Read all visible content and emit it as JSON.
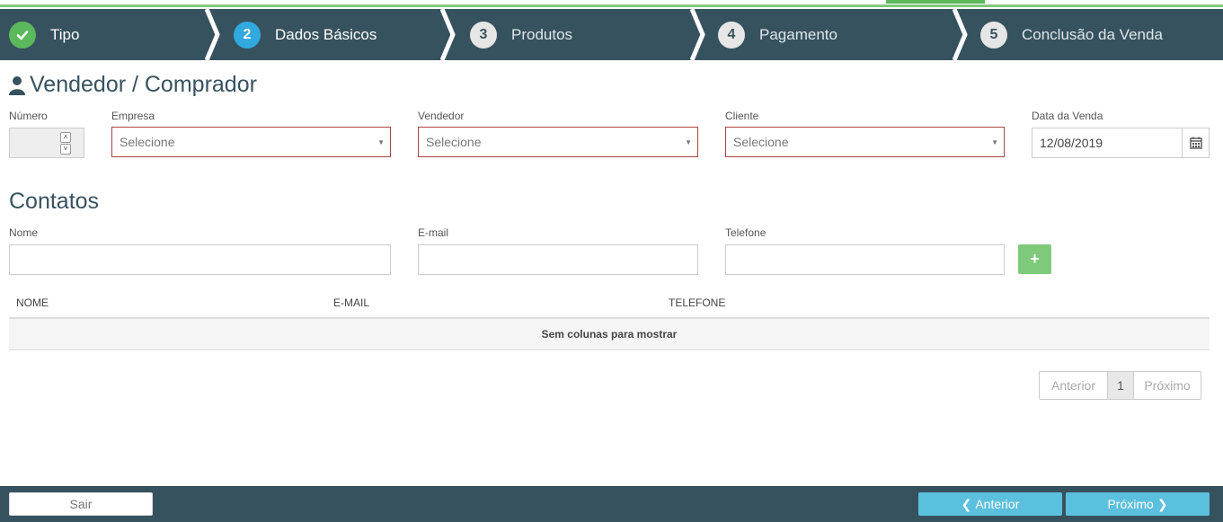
{
  "wizard": {
    "steps": [
      {
        "number": "",
        "label": "Tipo",
        "state": "done"
      },
      {
        "number": "2",
        "label": "Dados Básicos",
        "state": "active"
      },
      {
        "number": "3",
        "label": "Produtos",
        "state": "future"
      },
      {
        "number": "4",
        "label": "Pagamento",
        "state": "future"
      },
      {
        "number": "5",
        "label": "Conclusão da Venda",
        "state": "future"
      }
    ]
  },
  "seller_buyer": {
    "title": "Vendedor / Comprador",
    "numero_label": "Número",
    "numero_value": "",
    "empresa_label": "Empresa",
    "empresa_placeholder": "Selecione",
    "vendedor_label": "Vendedor",
    "vendedor_placeholder": "Selecione",
    "cliente_label": "Cliente",
    "cliente_placeholder": "Selecione",
    "data_label": "Data da Venda",
    "data_value": "12/08/2019"
  },
  "contacts": {
    "title": "Contatos",
    "nome_label": "Nome",
    "email_label": "E-mail",
    "telefone_label": "Telefone",
    "add_button": "+",
    "table": {
      "columns": [
        "NOME",
        "E-MAIL",
        "TELEFONE"
      ],
      "empty_message": "Sem colunas para mostrar"
    },
    "pager": {
      "prev": "Anterior",
      "page": "1",
      "next": "Próximo"
    }
  },
  "footer": {
    "exit_label": "Sair",
    "prev_label": "Anterior",
    "next_label": "Próximo"
  },
  "colors": {
    "header_bg": "#37525f",
    "done": "#5cb85c",
    "active": "#31a9de",
    "button_info": "#5bc0de",
    "error_border": "#a94442"
  }
}
